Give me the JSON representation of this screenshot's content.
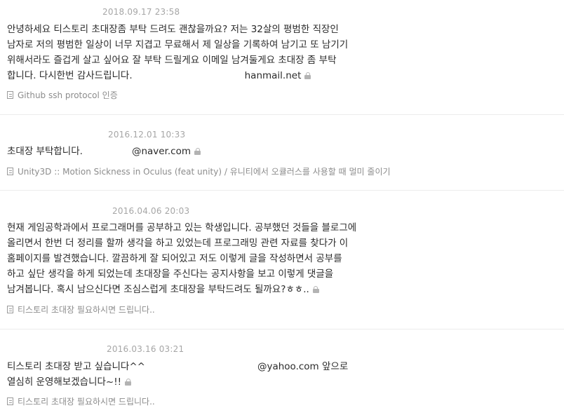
{
  "comments": [
    {
      "date": "2018.09.17 23:58",
      "text_before": "안녕하세요 티스토리 초대장좀 부탁 드려도 괜찮을까요? 저는 32살의 평범한 직장인 남자로 저의 평범한 일상이 너무 지겹고 무료해서 제 일상을 기록하여 남기고 또 남기기 위해서라도 즐겁게 살고 싶어요 잘 부탁 드릴게요 이메일 남겨둘게요 초대장 좀 부탁 합니다. 다시한번 감사드립니다.",
      "text_after": "hanmail.net",
      "post_title": "Github ssh protocol 인증"
    },
    {
      "date": "2016.12.01 10:33",
      "text_before": "초대장 부탁합니다.",
      "text_after": "@naver.com",
      "post_title": "Unity3D :: Motion Sickness in Oculus (feat unity) / 유니티에서 오큘러스를 사용할 때 멀미 줄이기"
    },
    {
      "date": "2016.04.06 20:03",
      "text_before": "현재 게임공학과에서 프로그래머를 공부하고 있는 학생입니다. 공부했던 것들을 블로그에 올리면서 한번 더 정리를 할까 생각을 하고 있었는데 프로그래밍 관련 자료를 찾다가 이 홈페이지를 발견했습니다. 깔끔하게 잘 되어있고 저도 이렇게 글을 작성하면서 공부를 하고 싶단 생각을 하게 되었는데 초대장을 주신다는 공지사항을 보고 이렇게 댓글을 남겨봅니다. 혹시 남으신다면 조심스럽게 초대장을 부탁드려도 될까요?ㅎㅎ..",
      "text_after": "",
      "post_title": "티스토리 초대장 필요하시면 드립니다.."
    },
    {
      "date": "2016.03.16 03:21",
      "text_before": "티스토리 초대장 받고 싶습니다^^",
      "text_after": "@yahoo.com 앞으로 열심히 운영해보겠습니다~!!",
      "post_title": "티스토리 초대장 필요하시면 드립니다.."
    }
  ],
  "icons": {
    "lock": "lock-icon",
    "post": "document-icon"
  }
}
